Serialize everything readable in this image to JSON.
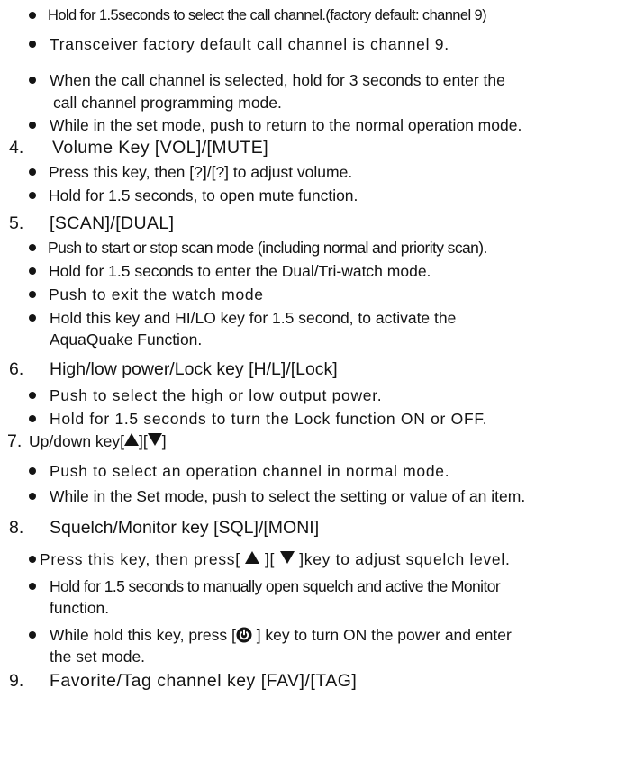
{
  "lines": {
    "l1": "Hold for 1.5seconds to select the call channel.(factory default: channel 9)",
    "l2": "Transceiver factory default call channel is channel 9.",
    "l3a": "When the call channel is selected, hold for 3 seconds to enter the",
    "l3b": "call channel programming mode.",
    "l4": "While in the set mode, push to return to the normal operation mode."
  },
  "sections": {
    "s4": {
      "number": "4.",
      "title": "Volume Key [VOL]/[MUTE]",
      "b1": "Press this key, then [?]/[?] to adjust volume.",
      "b2": "Hold for 1.5 seconds, to open mute function."
    },
    "s5": {
      "number": "5.",
      "title": "[SCAN]/[DUAL]",
      "b1": "Push to start or stop scan mode (including normal and priority scan).",
      "b2": "Hold for 1.5 seconds to enter the Dual/Tri-watch mode.",
      "b3": "Push to exit the watch mode",
      "b4a": "Hold this key and HI/LO key for 1.5 second, to activate the",
      "b4b": "AquaQuake Function."
    },
    "s6": {
      "number": "6.",
      "title": "High/low power/Lock key [H/L]/[Lock]",
      "b1": "Push to select the high or low output power.",
      "b2": "Hold for 1.5 seconds to turn the Lock function ON or OFF."
    },
    "s7": {
      "number": "7.",
      "title_pre": "Up/down key[",
      "title_mid": "][",
      "title_post": "]",
      "b1": "Push to select an operation channel in normal mode.",
      "b2": "While in the Set mode, push to select the setting or value of an item."
    },
    "s8": {
      "number": "8.",
      "title": "Squelch/Monitor key [SQL]/[MONI]",
      "b1_pre": "Press this key, then press[ ",
      "b1_mid": " ][ ",
      "b1_post": " ]key to adjust squelch level.",
      "b2a": "Hold for 1.5 seconds to manually open squelch and active the Monitor",
      "b2b": "function.",
      "b3a_pre": "While hold this key, press  [",
      "b3a_post": " ] key to turn ON the power and enter",
      "b3b": "the set mode."
    },
    "s9": {
      "number": "9.",
      "title": "Favorite/Tag channel key [FAV]/[TAG]"
    }
  },
  "icons": {
    "up": "up-triangle-icon",
    "down": "down-triangle-icon",
    "power": "power-icon"
  }
}
